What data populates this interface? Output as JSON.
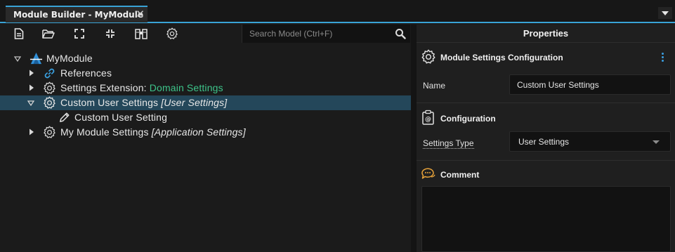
{
  "window": {
    "tab_title": "Module Builder - MyModule",
    "close_glyph": "✕"
  },
  "toolbar": {
    "buttons": [
      "new-file-icon",
      "open-folder-icon",
      "expand-all-icon",
      "collapse-all-icon",
      "binoculars-icon",
      "settings-gear-icon"
    ],
    "search_placeholder": "Search Model (Ctrl+F)",
    "search_value": ""
  },
  "tree": {
    "root": {
      "label": "MyModule",
      "icon": "module-logo-icon",
      "expanded": true
    },
    "items": [
      {
        "label": "References",
        "icon": "link-icon",
        "expanded": false
      },
      {
        "label": "Settings Extension:",
        "stereotype": "Domain Settings",
        "icon": "gear-icon",
        "expanded": false
      },
      {
        "label": "Custom User Settings",
        "stereotype": "[User Settings]",
        "icon": "gear-icon",
        "expanded": true,
        "selected": true
      },
      {
        "label": "Custom User Setting",
        "icon": "pencil-icon",
        "child": true
      },
      {
        "label": "My Module Settings",
        "stereotype": "[Application Settings]",
        "icon": "gear-icon",
        "expanded": false
      }
    ]
  },
  "properties": {
    "title": "Properties",
    "section1": {
      "title": "Module Settings Configuration",
      "icon": "gear-icon"
    },
    "name": {
      "label": "Name",
      "value": "Custom User Settings"
    },
    "section2": {
      "title": "Configuration",
      "icon": "configuration-icon"
    },
    "settings_type": {
      "label": "Settings Type",
      "value": "User Settings"
    },
    "section3": {
      "title": "Comment",
      "icon": "comment-icon"
    },
    "comment_value": ""
  },
  "colors": {
    "accent": "#39a3d6",
    "selection": "#24475a",
    "stereotype_green": "#3dc48a",
    "comment_orange": "#e8a33a"
  }
}
